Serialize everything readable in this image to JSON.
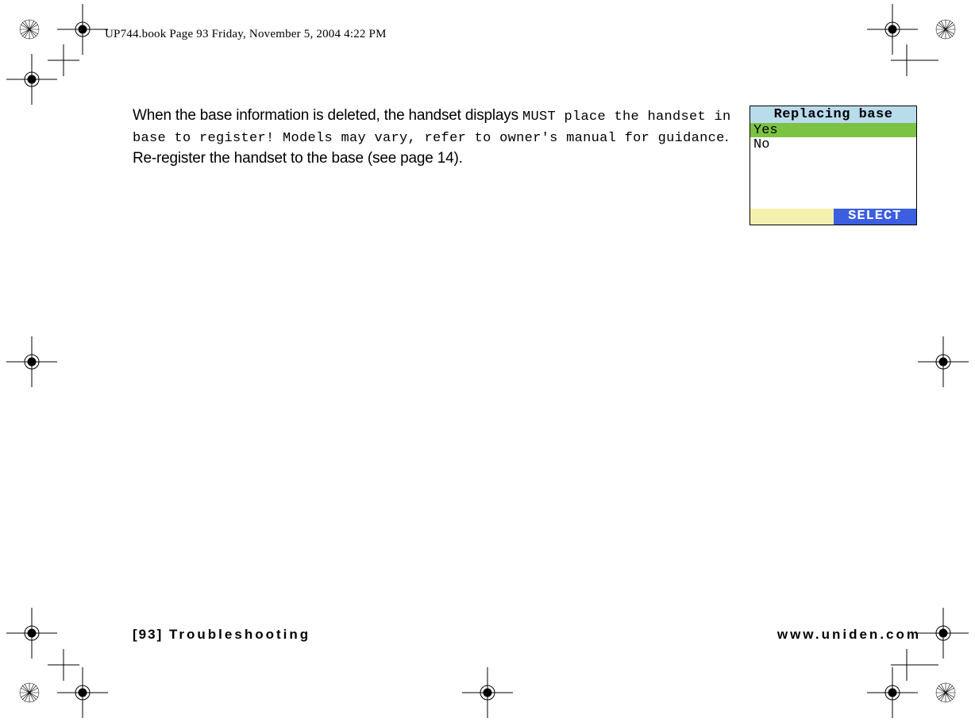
{
  "header": {
    "path_line": "UP744.book  Page 93  Friday, November 5, 2004  4:22 PM"
  },
  "paragraph": {
    "lead": "When the base information is deleted, the handset displays ",
    "lcd_msg": "MUST place the handset in base to register! Models may vary, refer to owner's manual for guidance",
    "tail": ". Re-register the handset to the base (see page 14)."
  },
  "lcd": {
    "title": "Replacing base",
    "option_yes": "Yes",
    "option_no": "No",
    "softkey_right": "SELECT"
  },
  "footer": {
    "page_num": "[93]",
    "section": "Troubleshooting",
    "url": "www.uniden.com"
  }
}
